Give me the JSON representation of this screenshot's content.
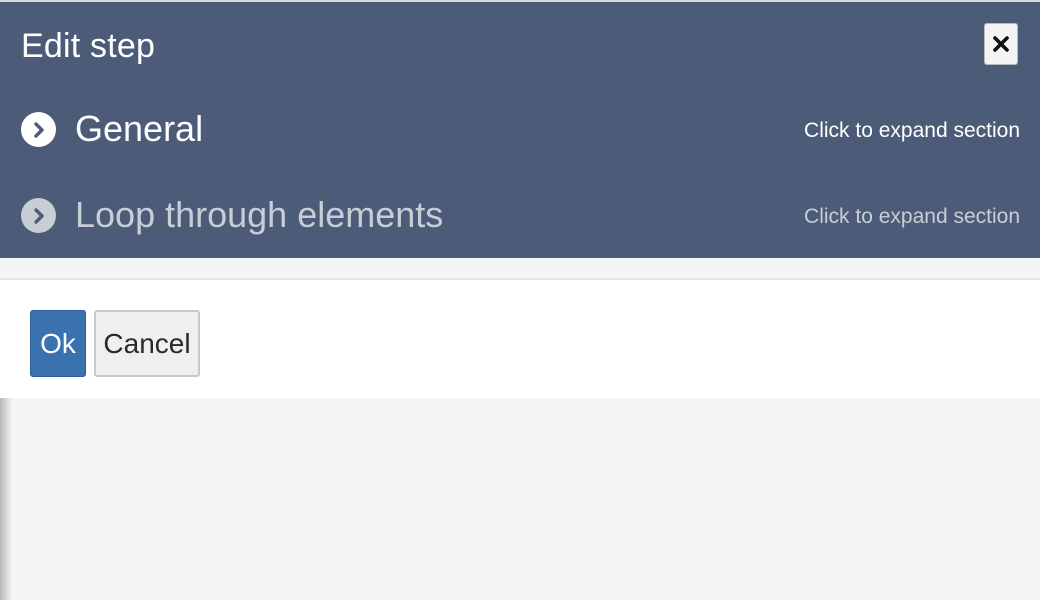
{
  "dialog": {
    "title": "Edit step",
    "close_icon": "close-icon"
  },
  "sections": [
    {
      "title": "General",
      "hint": "Click to expand section",
      "icon": "chevron-right-circle-icon",
      "state": "collapsed"
    },
    {
      "title": "Loop through elements",
      "hint": "Click to expand section",
      "icon": "chevron-right-circle-icon",
      "state": "collapsed-disabled"
    }
  ],
  "footer": {
    "ok_label": "Ok",
    "cancel_label": "Cancel"
  },
  "colors": {
    "header_bg": "#4b5b78",
    "primary_button": "#3a72b0",
    "page_bg": "#f5f5f5",
    "muted_text": "#c9cdd6"
  }
}
